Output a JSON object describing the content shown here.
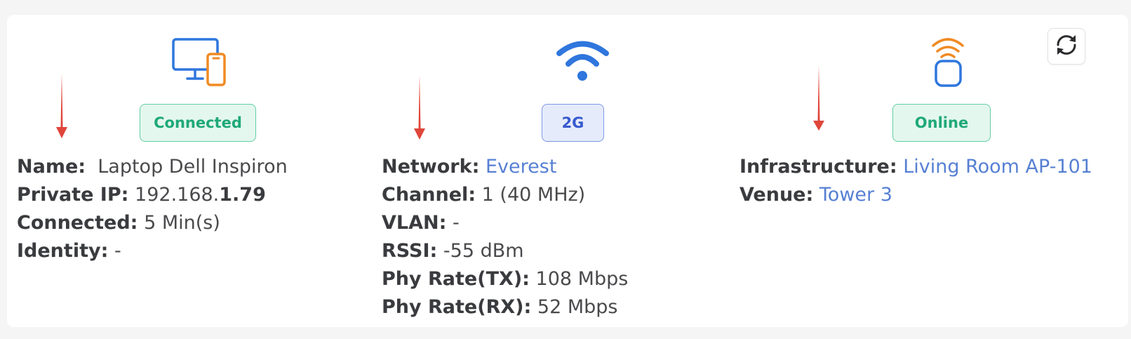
{
  "client": {
    "status_badge": "Connected",
    "name_label": "Name:",
    "name_value": "Laptop Dell Inspiron",
    "ip_label": "Private IP:",
    "ip_prefix": "192.168.",
    "ip_suffix": "1.79",
    "connected_label": "Connected:",
    "connected_value": "5 Min(s)",
    "identity_label": "Identity:",
    "identity_value": "-",
    "icon": "devices-icon"
  },
  "network": {
    "band_badge": "2G",
    "network_label": "Network:",
    "network_value": "Everest",
    "channel_label": "Channel:",
    "channel_value": "1 (40 MHz)",
    "vlan_label": "VLAN:",
    "vlan_value": "-",
    "rssi_label": "RSSI:",
    "rssi_value": "-55 dBm",
    "tx_label": "Phy Rate(TX):",
    "tx_value": "108 Mbps",
    "rx_label": "Phy Rate(RX):",
    "rx_value": "52 Mbps",
    "icon": "wifi-icon"
  },
  "infrastructure": {
    "status_badge": "Online",
    "infra_label": "Infrastructure:",
    "infra_value": "Living Room AP-101",
    "venue_label": "Venue:",
    "venue_value": "Tower 3",
    "icon": "access-point-icon"
  },
  "toolbar": {
    "refresh_icon": "refresh-icon"
  },
  "colors": {
    "accent_blue": "#2f76dd",
    "accent_orange": "#f08a24",
    "success_green": "#1fa977",
    "badge_blue": "#3859cf",
    "link_blue": "#5780d3",
    "arrow_red": "#e0453a"
  }
}
